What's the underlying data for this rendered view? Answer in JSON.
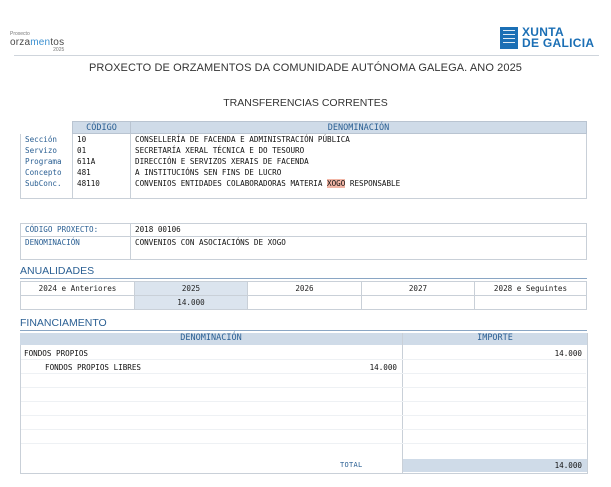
{
  "header": {
    "logo_left": {
      "small": "Proxecto",
      "brand_a": "orza",
      "brand_b": "men",
      "brand_c": "tos",
      "year": "2025"
    },
    "logo_right": {
      "line1": "XUNTA",
      "line2": "DE GALICIA"
    },
    "title": "PROXECTO DE ORZAMENTOS DA COMUNIDADE AUTÓNOMA GALEGA. ANO 2025",
    "section": "TRANSFERENCIAS CORRENTES"
  },
  "classification": {
    "header_code": "CÓDIGO",
    "header_name": "DENOMINACIÓN",
    "rows": [
      {
        "label": "Sección",
        "code": "10",
        "name": "CONSELLERÍA DE FACENDA E ADMINISTRACIÓN PÚBLICA"
      },
      {
        "label": "Servizo",
        "code": "01",
        "name": "SECRETARÍA XERAL TÉCNICA E DO TESOURO"
      },
      {
        "label": "Programa",
        "code": "611A",
        "name": "DIRECCIÓN E SERVIZOS XERAIS DE  FACENDA"
      },
      {
        "label": "Concepto",
        "code": "481",
        "name": "A INSTITUCIÓNS SEN FINS DE LUCRO"
      },
      {
        "label": "SubConc.",
        "code": "48110",
        "name_a": "CONVENIOS ENTIDADES COLABORADORAS MATERIA ",
        "name_hl": "XOGO",
        "name_b": " RESPONSABLE"
      }
    ]
  },
  "project": {
    "code_label": "CÓDIGO PROXECTO:",
    "code_value": "2018 00106",
    "name_label": "DENOMINACIÓN",
    "name_value": "CONVENIOS CON ASOCIACIÓNS DE XOGO"
  },
  "anualidades": {
    "title": "ANUALIDADES",
    "headers": [
      "2024 e Anteriores",
      "2025",
      "2026",
      "2027",
      "2028 e Seguintes"
    ],
    "values": [
      "",
      "14.000",
      "",
      "",
      ""
    ]
  },
  "financiamento": {
    "title": "FINANCIAMENTO",
    "header_name": "DENOMINACIÓN",
    "header_amount": "IMPORTE",
    "items": [
      {
        "name": "FONDOS PROPIOS",
        "sub_amount": "",
        "amount": "14.000"
      },
      {
        "name": "FONDOS PROPIOS LIBRES",
        "sub_amount": "14.000",
        "amount": ""
      }
    ],
    "total_label": "TOTAL",
    "total_value": "14.000"
  }
}
